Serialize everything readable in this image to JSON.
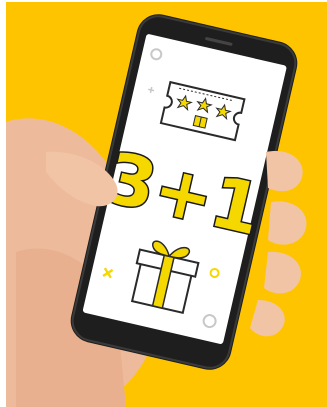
{
  "background_color": "#FFC400",
  "accent_color": "#F5D800",
  "phone_color": "#1E1E1E",
  "screen_color": "#FFFFFF",
  "skin_color": "#F1C4A6",
  "promo": {
    "text": "3+1"
  },
  "icons": {
    "ticket": "ticket-with-stars-and-gift-icon",
    "gift": "gift-box-icon"
  }
}
